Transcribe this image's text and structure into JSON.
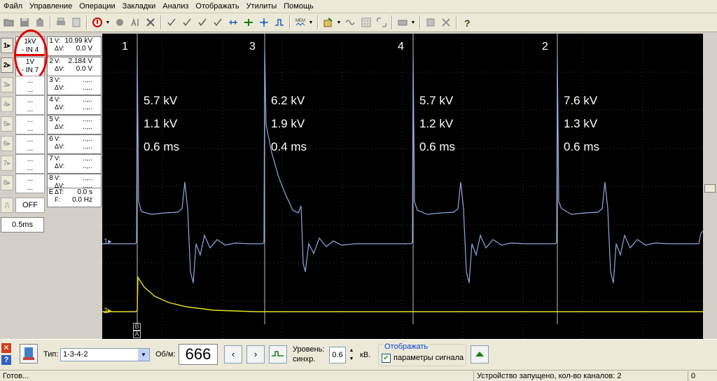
{
  "menu": [
    "Файл",
    "Управление",
    "Операции",
    "Закладки",
    "Анализ",
    "Отображать",
    "Утилиты",
    "Помощь"
  ],
  "channels": [
    {
      "num": "1",
      "range": "1kV",
      "input": "- IN 4",
      "v": "10.99 kV",
      "dv": "0.0 V"
    },
    {
      "num": "2",
      "range": "1V",
      "input": "- IN 7",
      "v": "2.184 V",
      "dv": "0.0 V"
    },
    {
      "num": "3",
      "range": "...",
      "input": "...",
      "v": "..,..",
      "dv": "..,.."
    },
    {
      "num": "4",
      "range": "...",
      "input": "...",
      "v": "..,..",
      "dv": "..,.."
    },
    {
      "num": "5",
      "range": "...",
      "input": "...",
      "v": "..,..",
      "dv": "..,.."
    },
    {
      "num": "6",
      "range": "...",
      "input": "...",
      "v": "..,..",
      "dv": "..,.."
    },
    {
      "num": "7",
      "range": "...",
      "input": "...",
      "v": "..,..",
      "dv": "..,.."
    },
    {
      "num": "8",
      "range": "...",
      "input": "...",
      "v": "..,..",
      "dv": "..,.."
    }
  ],
  "meas_labels": {
    "v": "V:",
    "dv": "ΔV:"
  },
  "extra": {
    "e_label": "E",
    "e_sub": "ΔT:",
    "e_val": "0.0 s",
    "f_label": "F:",
    "f_val": "0.0 Hz"
  },
  "trigger": {
    "off_label": "OFF",
    "timebase": "0.5ms"
  },
  "scope": {
    "cylinders": [
      {
        "label": "1",
        "kv": "5.7 kV",
        "burn_kv": "1.1 kV",
        "ms": "0.6 ms"
      },
      {
        "label": "3",
        "kv": "6.2 kV",
        "burn_kv": "1.9 kV",
        "ms": "0.4 ms"
      },
      {
        "label": "4",
        "kv": "5.7 kV",
        "burn_kv": "1.2 kV",
        "ms": "0.6 ms"
      },
      {
        "label": "2",
        "kv": "7.6 kV",
        "burn_kv": "1.3 kV",
        "ms": "0.6 ms"
      }
    ],
    "ch1_marker": "1",
    "ch2_marker": "2",
    "cursor_b": "B",
    "cursor_a": "A",
    "colors": {
      "ch1": "#8fa8e0",
      "ch2": "#e8e020",
      "grid": "#3a3a3a",
      "cursor": "#c0c0c0"
    }
  },
  "bottom": {
    "type_label": "Тип:",
    "type_value": "1-3-4-2",
    "rpm_label": "Об/м:",
    "rpm_value": "666",
    "level_label": "Уровень:",
    "sync_label": "синхр.",
    "level_value": "0.6",
    "level_unit": "кВ.",
    "display_group": "Отображать",
    "params_label": "параметры сигнала"
  },
  "status": {
    "ready": "Готов...",
    "device": "Устройство запущено, кол-во каналов: 2",
    "counter": "0"
  }
}
